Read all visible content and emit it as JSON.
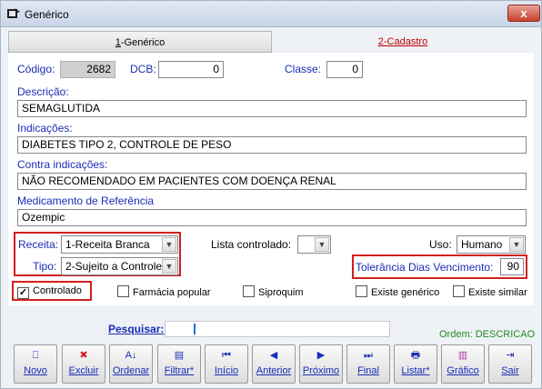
{
  "window": {
    "title": "Genérico",
    "close_label": "x"
  },
  "tabs": [
    {
      "label": "1-Genérico",
      "accel": "1",
      "rest": "-Genérico"
    },
    {
      "label": "2-Cadastro"
    }
  ],
  "form": {
    "codigo_label": "Código:",
    "codigo_value": "2682",
    "dcb_label": "DCB:",
    "dcb_value": "0",
    "classe_label": "Classe:",
    "classe_value": "0",
    "descricao_label": "Descrição:",
    "descricao_value": "SEMAGLUTIDA",
    "indicacoes_label": "Indicações:",
    "indicacoes_value": "DIABETES TIPO 2, CONTROLE DE PESO",
    "contra_label": "Contra indicações:",
    "contra_value": "NÃO RECOMENDADO EM PACIENTES COM DOENÇA RENAL",
    "referencia_label": "Medicamento de Referência",
    "referencia_value": "Ozempic",
    "receita_label": "Receita:",
    "receita_value": "1-Receita Branca",
    "tipo_label": "Tipo:",
    "tipo_value": "2-Sujeito a Controle",
    "lista_label": "Lista controlado:",
    "lista_value": "",
    "uso_label": "Uso:",
    "uso_value": "Humano",
    "tolerancia_label": "Tolerância Dias Vencimento:",
    "tolerancia_value": "90"
  },
  "checkboxes": [
    {
      "label": "Controlado",
      "checked": true
    },
    {
      "label": "Farmácia popular",
      "checked": false
    },
    {
      "label": "Siproquim",
      "checked": false
    },
    {
      "label": "Existe genérico",
      "checked": false
    },
    {
      "label": "Existe similar",
      "checked": false
    }
  ],
  "search": {
    "label": "Pesquisar:",
    "value": "",
    "order": "Ordem: DESCRICAO"
  },
  "toolbar": [
    {
      "label": "Novo",
      "icon": "new-icon",
      "glyph": "⎕"
    },
    {
      "label": "Excluir",
      "icon": "delete-icon",
      "glyph": "✖"
    },
    {
      "label": "Ordenar",
      "icon": "sort-icon",
      "glyph": "A↓"
    },
    {
      "label": "Filtrar*",
      "icon": "filter-icon",
      "glyph": "▤"
    },
    {
      "label": "Início",
      "icon": "first-icon",
      "glyph": "⏮"
    },
    {
      "label": "Anterior",
      "icon": "previous-icon",
      "glyph": "◀"
    },
    {
      "label": "Próximo",
      "icon": "next-icon",
      "glyph": "▶"
    },
    {
      "label": "Final",
      "icon": "last-icon",
      "glyph": "⏭"
    },
    {
      "label": "Listar*",
      "icon": "print-icon",
      "glyph": "🖶"
    },
    {
      "label": "Gráfico",
      "icon": "chart-icon",
      "glyph": "▥"
    },
    {
      "label": "Sair",
      "icon": "exit-icon",
      "glyph": "⇥"
    }
  ],
  "colors": {
    "label_blue": "#1a2db5",
    "highlight_red": "#d21f1f",
    "order_green": "#1f8b1f"
  }
}
